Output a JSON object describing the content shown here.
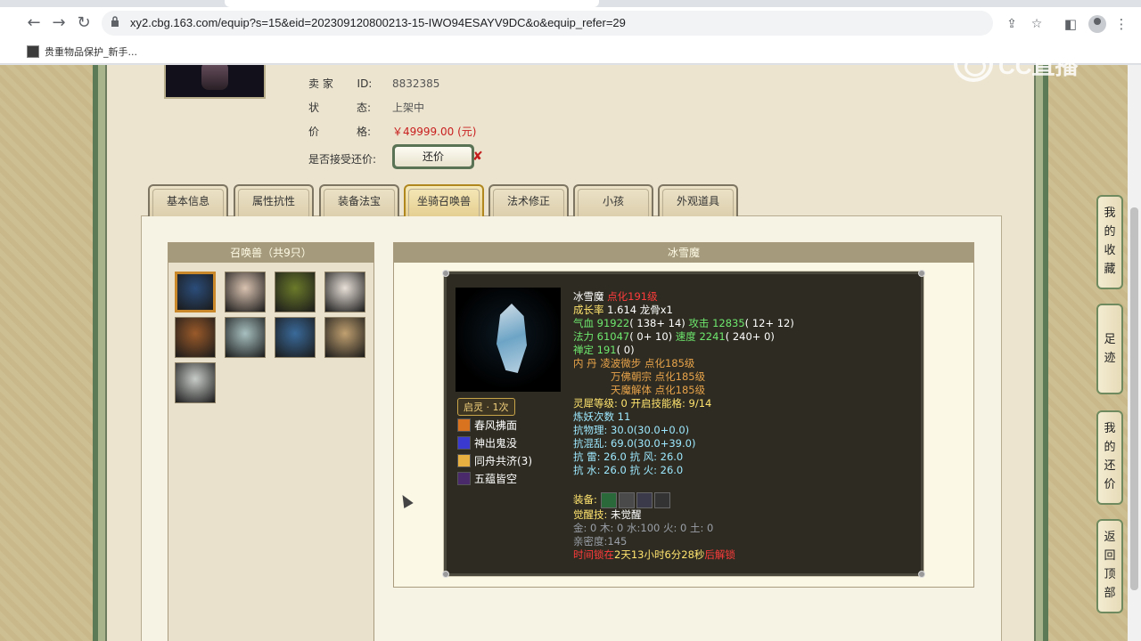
{
  "browser": {
    "url": "xy2.cbg.163.com/equip?s=15&eid=202309120800213-15-IWO94ESAYV9DC&o&equip_refer=29",
    "bookmark": "贵重物品保护_新手..."
  },
  "watermark": "CC直播",
  "seller": {
    "id_label_left": "卖  家",
    "id_label": "ID:",
    "id_value": "8832385",
    "status_label_left": "状",
    "status_label": "态:",
    "status_value": "上架中",
    "price_label_left": "价",
    "price_label": "格:",
    "price_value": "￥49999.00 (元)",
    "counter_label": "是否接受还价:",
    "counter_button": "还价",
    "counter_mark": "✘"
  },
  "tabs": [
    "基本信息",
    "属性抗性",
    "装备法宝",
    "坐骑召唤兽",
    "法术修正",
    "小孩",
    "外观道具"
  ],
  "active_tab": 3,
  "pets": {
    "title": "召唤兽（共9只）",
    "colors": [
      "#2b4d7a",
      "#d9c2b0",
      "#6b7a2a",
      "#e8e0d8",
      "#9a5a2a",
      "#a8c0c0",
      "#3a6a9a",
      "#c0a070",
      "#c8ccc8"
    ]
  },
  "detail": {
    "title": "冰雪魔",
    "name": "冰雪魔",
    "name_tag": "点化191级",
    "growth_label": "成长率",
    "growth_value": "1.614",
    "dragon": "龙骨x1",
    "hp_label": "气血",
    "hp_value": "91922",
    "hp_extra": "( 138+ 14)",
    "atk_label": "攻击",
    "atk_value": "12835",
    "atk_extra": "( 12+ 12)",
    "mp_label": "法力",
    "mp_value": "61047",
    "mp_extra": "( 0+ 10)",
    "spd_label": "速度",
    "spd_value": "2241",
    "spd_extra": "( 240+ 0)",
    "zen_label": "禅定",
    "zen_value": "191",
    "zen_extra": "( 0)",
    "neidan_label": "内  丹",
    "neidan": [
      "凌波微步 点化185级",
      "万佛朝宗 点化185级",
      "天魔解体 点化185级"
    ],
    "lingxi_label": "灵犀等级:",
    "lingxi_value": "0",
    "lingxi_open": "开启技能格:",
    "lingxi_slots": "9/14",
    "refine_label": "炼妖次数",
    "refine_value": "11",
    "res_phys": "抗物理: 30.0(30.0+0.0)",
    "res_chaos": "抗混乱: 69.0(30.0+39.0)",
    "res_row1": "抗   雷: 26.0 抗   风: 26.0",
    "res_row2": "抗   水: 26.0 抗   火: 26.0",
    "equip_label": "装备:",
    "awaken_label": "觉醒技:",
    "awaken_value": "未觉醒",
    "elements": "金: 0 木: 0 水:100 火: 0 土: 0",
    "intimacy": "亲密度:145",
    "time_prefix": "时间锁在",
    "time_value": "2天13小时6分28秒",
    "time_suffix": "后解锁",
    "qiling": "启灵 · 1次",
    "skills": [
      {
        "name": "春风拂面",
        "color": "#d9731f"
      },
      {
        "name": "神出鬼没",
        "color": "#3a3ad0"
      },
      {
        "name": "同舟共济(3)",
        "color": "#e8b040"
      },
      {
        "name": "五蕴皆空",
        "color": "#4a2a6a"
      }
    ]
  },
  "side_buttons": [
    {
      "label": "我的收藏"
    },
    {
      "label": "足迹"
    },
    {
      "label": "我的还价"
    },
    {
      "label": "返回顶部"
    }
  ]
}
